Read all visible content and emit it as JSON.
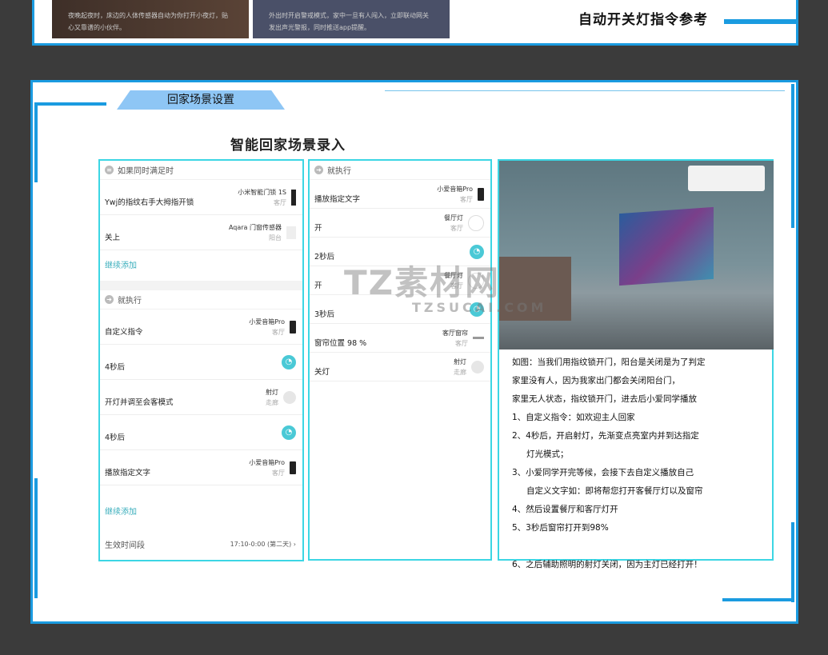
{
  "top": {
    "cards": [
      {
        "text": "夜晚起夜时，床边的人体传感器自动为你打开小夜灯，贴心又靠谱的小伙伴。"
      },
      {
        "text": "外出时开启警戒模式，家中一旦有人闯入，立即联动网关发出声光警报，同时推送app提醒。"
      }
    ],
    "title": "自动开关灯指令参考"
  },
  "section": {
    "tab": "回家场景设置",
    "subtitle": "智能回家场景录入"
  },
  "left_panel": {
    "if_header": "如果同时满足时",
    "conditions": [
      {
        "label": "Ywj的指纹右手大拇指开锁",
        "device": "小米智能门锁 1S",
        "room": "客厅",
        "icon": "lock"
      },
      {
        "label": "关上",
        "device": "Aqara 门窗传感器",
        "room": "阳台",
        "icon": "sensor"
      }
    ],
    "add1": "继续添加",
    "then_header": "就执行",
    "actions": [
      {
        "label": "自定义指令",
        "device": "小爱音箱Pro",
        "room": "客厅",
        "icon": "speaker"
      },
      {
        "label": "4秒后",
        "icon": "timer"
      },
      {
        "label": "开灯并调至会客模式",
        "device": "射灯",
        "room": "走廊",
        "icon": "bulb"
      },
      {
        "label": "4秒后",
        "icon": "timer"
      },
      {
        "label": "播放指定文字",
        "device": "小爱音箱Pro",
        "room": "客厅",
        "icon": "speaker"
      }
    ],
    "add2": "继续添加",
    "period_label": "生效时间段",
    "period_value": "17:10-0:00 (第二天) ›"
  },
  "middle_panel": {
    "then_header": "就执行",
    "actions": [
      {
        "label": "播放指定文字",
        "device": "小爱音箱Pro",
        "room": "客厅",
        "icon": "speaker"
      },
      {
        "label": "开",
        "device": "餐厅灯",
        "room": "客厅",
        "icon": "lamp"
      },
      {
        "label": "2秒后",
        "icon": "timer"
      },
      {
        "label": "开",
        "device": "餐厅灯",
        "room": "客厅",
        "icon": "lamp"
      },
      {
        "label": "3秒后",
        "icon": "timer"
      },
      {
        "label": "窗帘位置 98 %",
        "device": "客厅窗帘",
        "room": "客厅",
        "icon": "curtain"
      },
      {
        "label": "关灯",
        "device": "射灯",
        "room": "走廊",
        "icon": "bulb"
      }
    ]
  },
  "right_panel": {
    "lines": [
      {
        "text": "如图：当我们用指纹锁开门，阳台是关闭是为了判定"
      },
      {
        "text": "家里没有人，因为我家出门都会关闭阳台门，"
      },
      {
        "text": "家里无人状态，指纹锁开门，进去后小爱同学播放"
      },
      {
        "text": "1、自定义指令：如欢迎主人回家"
      },
      {
        "text": "2、4秒后，开启射灯，先渐变点亮室内并到达指定"
      },
      {
        "text": "灯光模式；",
        "indent": true
      },
      {
        "text": "3、小爱同学开完等候，会接下去自定义播放自己"
      },
      {
        "text": "自定义文字如：即将帮您打开客餐厅灯以及窗帘",
        "indent": true
      },
      {
        "text": "4、然后设置餐厅和客厅灯开"
      },
      {
        "text": "5、3秒后窗帘打开到98%"
      },
      {
        "text": ""
      },
      {
        "text": "6、之后辅助照明的射灯关闭，因为主灯已经打开！"
      }
    ]
  },
  "watermark": {
    "main": "TZ素材网",
    "sub": "TZSUCAI.COM"
  },
  "colors": {
    "frame": "#1a9be0",
    "panel_border": "#3cd6e4",
    "accent": "#4ac9d6"
  }
}
